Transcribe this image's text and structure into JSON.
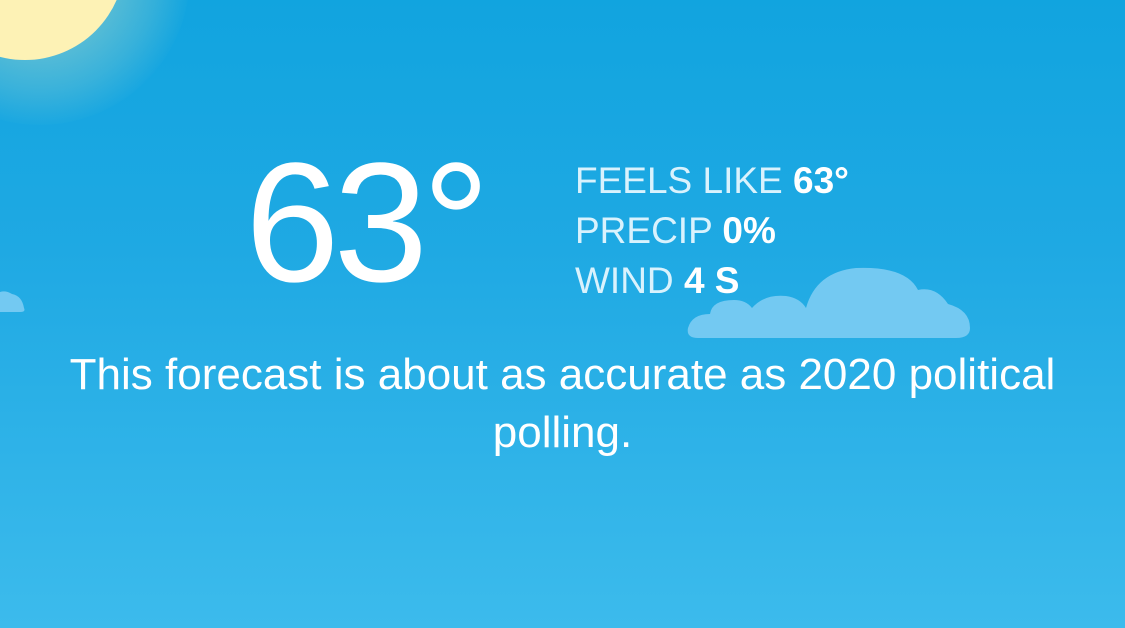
{
  "weather": {
    "temperature": "63°",
    "details": [
      {
        "label": "FEELS LIKE",
        "value": "63°"
      },
      {
        "label": "PRECIP",
        "value": "0%"
      },
      {
        "label": "WIND",
        "value": "4 S"
      }
    ],
    "message": "This forecast is about as accurate as 2020 political polling."
  },
  "icons": {
    "sun": "sun-icon",
    "cloud": "cloud-icon"
  },
  "colors": {
    "sky_top": "#11a4df",
    "sky_bottom": "#3cbbec",
    "sun": "#fdf2b5",
    "cloud": "#73c9f2",
    "text": "#ffffff",
    "label": "#d9f2fd"
  }
}
